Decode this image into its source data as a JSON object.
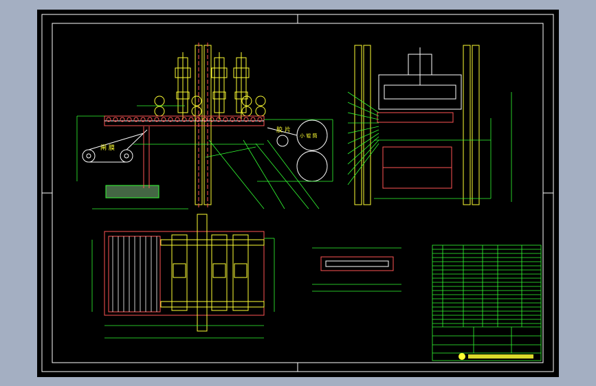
{
  "drawing": {
    "background": "#000000",
    "frame_color": "#ffffff",
    "part_color": "#ffff33",
    "dimension_color": "#33ff33",
    "outline_color": "#ff5555",
    "section_color": "#7777ff"
  },
  "annotations": {
    "left_label_a": "闸 膜",
    "right_label_a": "胶 片",
    "right_label_b": "小 辊 筒"
  },
  "title_block": {
    "company": "",
    "rows": 20
  }
}
